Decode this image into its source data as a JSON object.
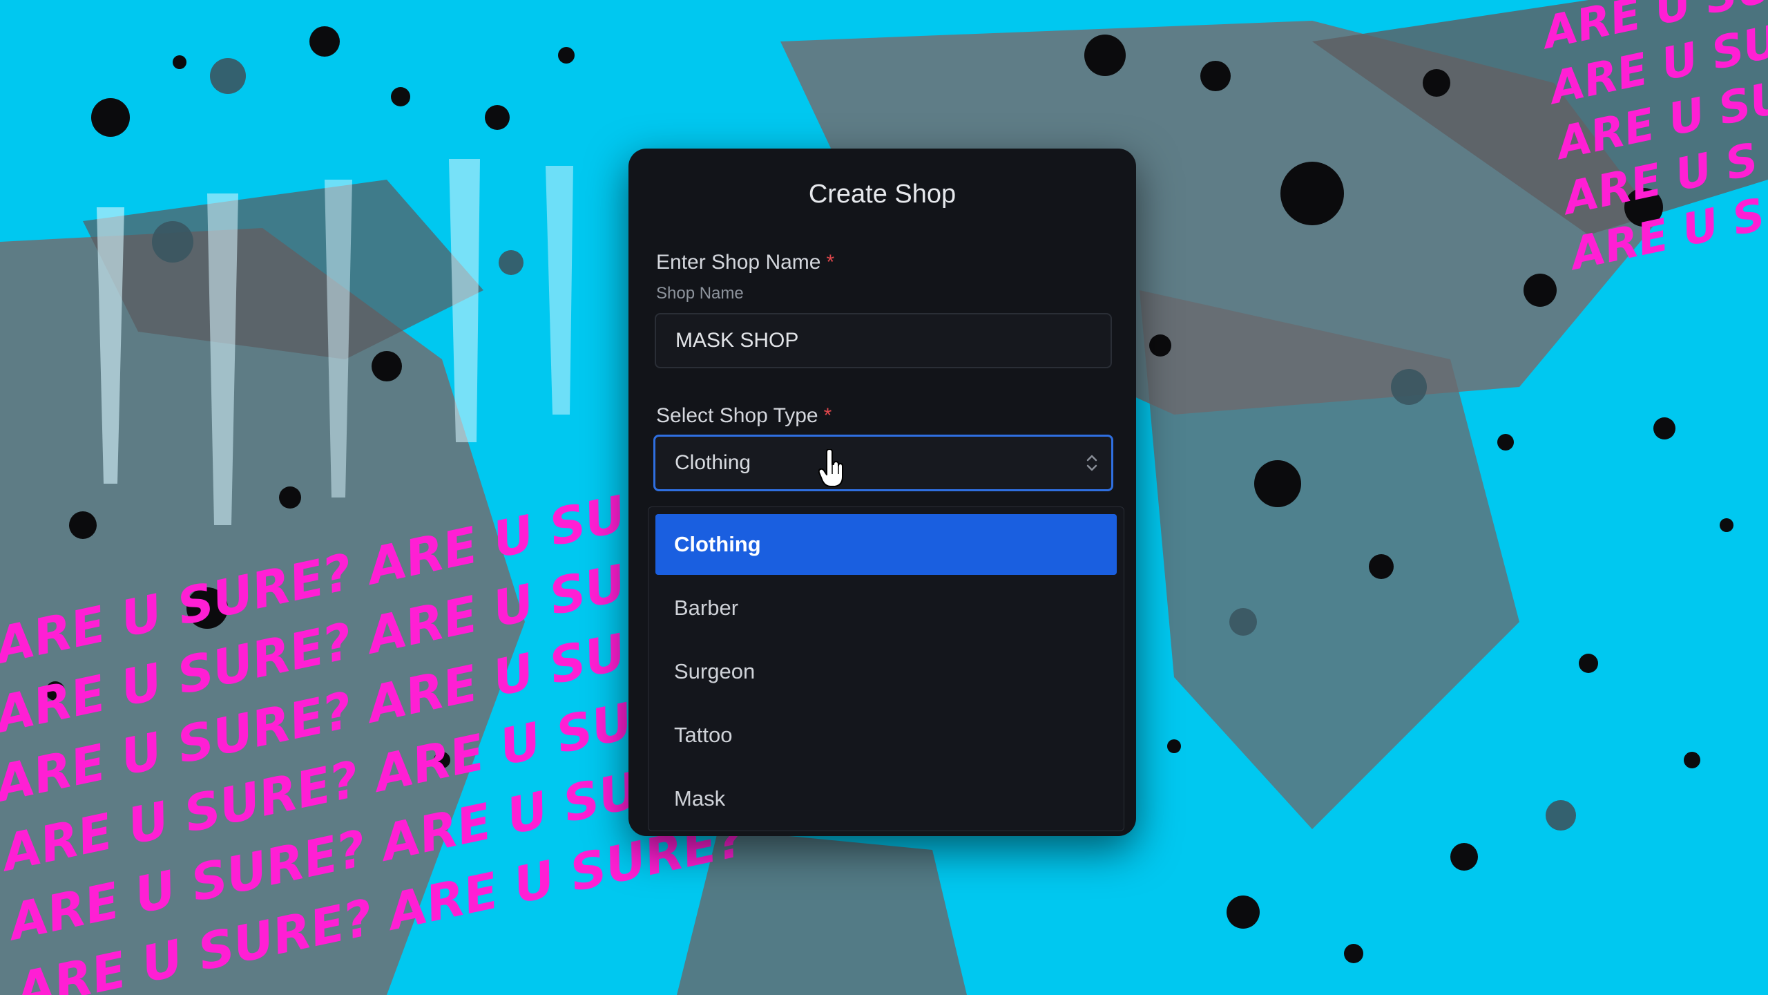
{
  "modal": {
    "title": "Create Shop",
    "shop_name": {
      "label": "Enter Shop Name",
      "required_mark": "*",
      "sublabel": "Shop Name",
      "value": "MASK SHOP",
      "placeholder": "Shop Name"
    },
    "shop_type": {
      "label": "Select Shop Type",
      "required_mark": "*",
      "selected": "Clothing",
      "options": [
        "Clothing",
        "Barber",
        "Surgeon",
        "Tattoo",
        "Mask"
      ]
    }
  },
  "backdrop": {
    "graffiti_text": "ARE U SURE?"
  },
  "colors": {
    "background": "#00c8f0",
    "modal": "#121419",
    "accent": "#1a5fe0",
    "required": "#e0474c",
    "graffiti": "#ff1fd4"
  },
  "icons": {
    "select": "chevron-updown-icon",
    "cursor": "hand-pointer-icon"
  }
}
